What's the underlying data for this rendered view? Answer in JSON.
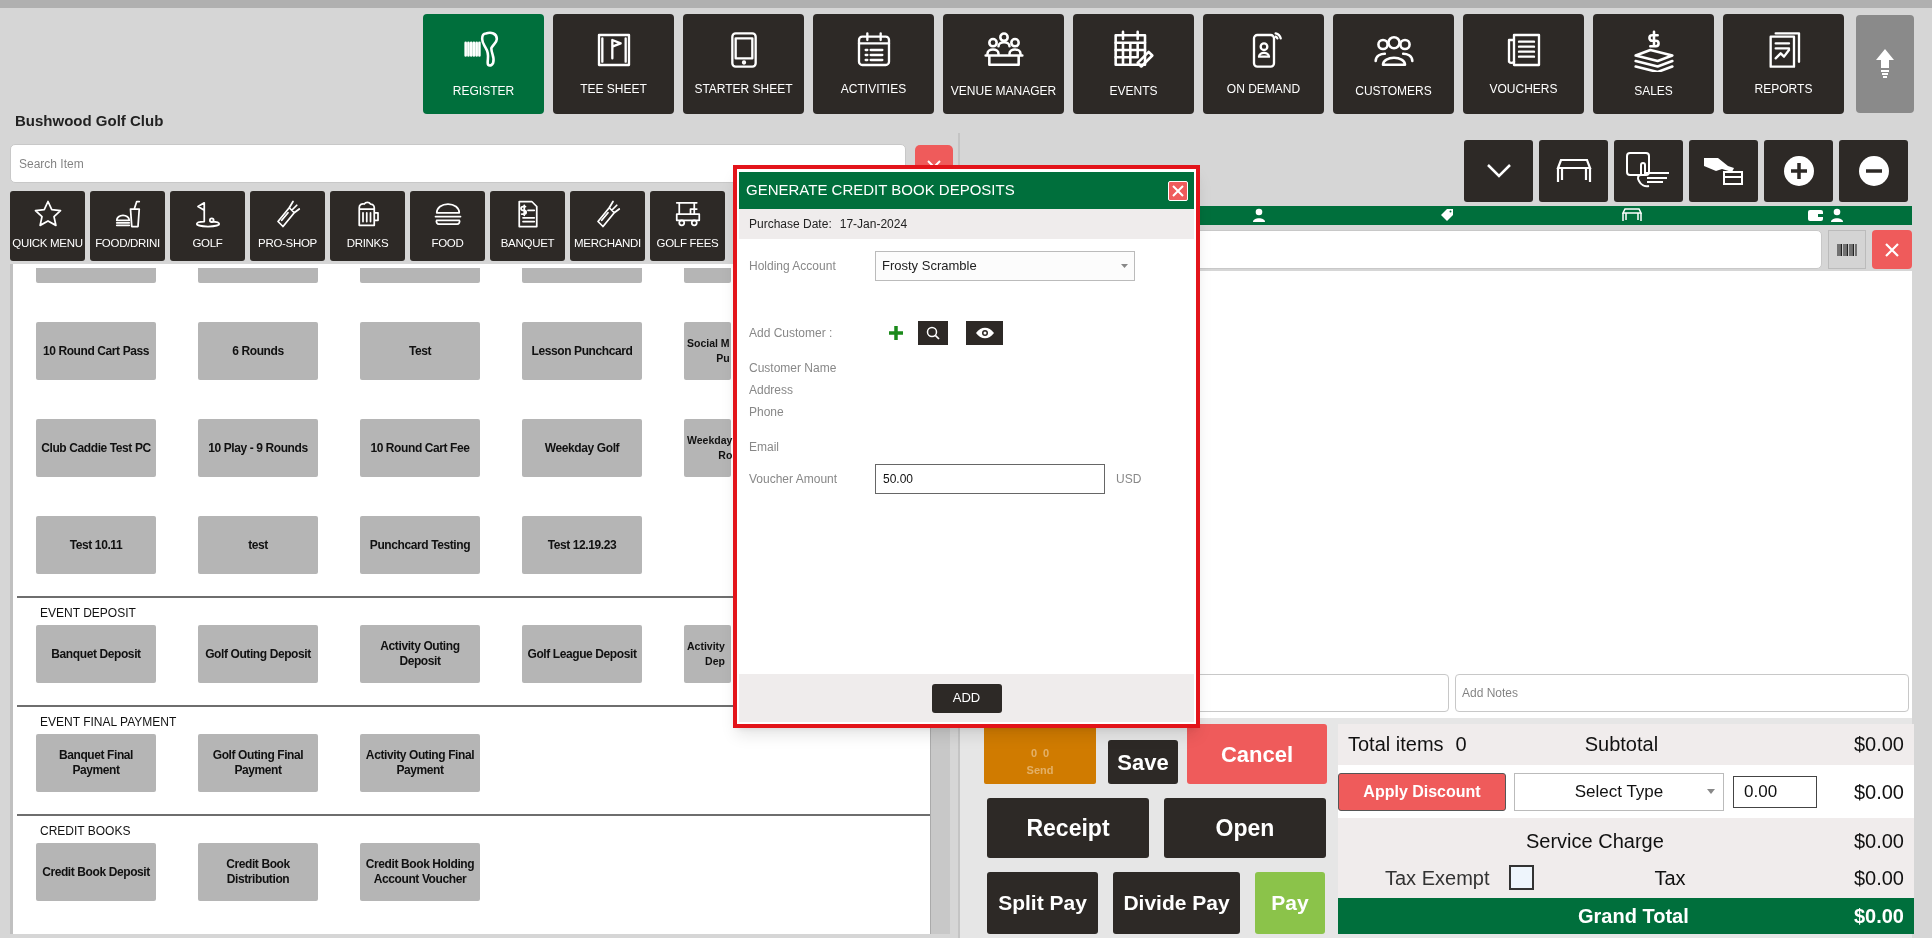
{
  "app_title": "Bushwood Golf Club",
  "nav": [
    {
      "label": "REGISTER",
      "selected": true
    },
    {
      "label": "TEE SHEET",
      "selected": false
    },
    {
      "label": "STARTER SHEET",
      "selected": false
    },
    {
      "label": "ACTIVITIES",
      "selected": false
    },
    {
      "label": "VENUE MANAGER",
      "selected": false
    },
    {
      "label": "EVENTS",
      "selected": false
    },
    {
      "label": "ON DEMAND",
      "selected": false
    },
    {
      "label": "CUSTOMERS",
      "selected": false
    },
    {
      "label": "VOUCHERS",
      "selected": false
    },
    {
      "label": "SALES",
      "selected": false
    },
    {
      "label": "REPORTS",
      "selected": false
    }
  ],
  "search": {
    "placeholder": "Search Item"
  },
  "categories": [
    {
      "label": "QUICK MENU"
    },
    {
      "label": "FOOD/DRINI"
    },
    {
      "label": "GOLF"
    },
    {
      "label": "PRO-SHOP"
    },
    {
      "label": "DRINKS"
    },
    {
      "label": "FOOD"
    },
    {
      "label": "BANQUET"
    },
    {
      "label": "MERCHANDI"
    },
    {
      "label": "GOLF FEES"
    }
  ],
  "item_groups": [
    {
      "rows": [
        [
          {
            "label": "10 Round Cart Pass"
          },
          {
            "label": "6 Rounds"
          },
          {
            "label": "Test"
          },
          {
            "label": "Lesson Punchcard"
          },
          {
            "label": "Social M\nPu",
            "cut": true
          }
        ],
        [
          {
            "label": "Club Caddie Test PC"
          },
          {
            "label": "10 Play - 9 Rounds"
          },
          {
            "label": "10 Round Cart Fee"
          },
          {
            "label": "Weekday Golf"
          },
          {
            "label": "Weekday\nRo",
            "cut": true
          }
        ],
        [
          {
            "label": "Test 10.11"
          },
          {
            "label": "test"
          },
          {
            "label": "Punchcard Testing"
          },
          {
            "label": "Test 12.19.23"
          }
        ]
      ]
    },
    {
      "title": "EVENT DEPOSIT",
      "rows": [
        [
          {
            "label": "Banquet Deposit"
          },
          {
            "label": "Golf Outing Deposit"
          },
          {
            "label": "Activity Outing Deposit"
          },
          {
            "label": "Golf League Deposit"
          },
          {
            "label": "Activity\nDep",
            "cut": true
          }
        ]
      ]
    },
    {
      "title": "EVENT FINAL PAYMENT",
      "rows": [
        [
          {
            "label": "Banquet Final Payment"
          },
          {
            "label": "Golf Outing Final Payment"
          },
          {
            "label": "Activity Outing Final Payment"
          }
        ]
      ]
    },
    {
      "title": "CREDIT BOOKS",
      "rows": [
        [
          {
            "label": "Credit Book Deposit"
          },
          {
            "label": "Credit Book Distribution"
          },
          {
            "label": "Credit Book Holding Account Voucher"
          }
        ]
      ]
    }
  ],
  "notes": {
    "placeholder": "Add Notes"
  },
  "send": {
    "counts": [
      "0",
      "0"
    ],
    "label": "Send",
    "disabled": true
  },
  "actions": [
    {
      "label": "Save",
      "kind": "dark"
    },
    {
      "label": "Cancel",
      "kind": "red"
    },
    {
      "label": "Receipt",
      "kind": "dark"
    },
    {
      "label": "Open",
      "kind": "dark"
    },
    {
      "label": "Split Pay",
      "kind": "dark"
    },
    {
      "label": "Divide Pay",
      "kind": "dark"
    },
    {
      "label": "Pay",
      "kind": "green"
    }
  ],
  "summary": {
    "total_items_label": "Total items",
    "total_items": "0",
    "subtotal_label": "Subtotal",
    "subtotal": "$0.00",
    "apply_discount": "Apply Discount",
    "discount_type": "Select Type",
    "discount_value": "0.00",
    "discount_amount": "$0.00",
    "service_charge_label": "Service Charge",
    "service_charge": "$0.00",
    "tax_exempt": {
      "label": "Tax Exempt",
      "checked": false
    },
    "tax_label": "Tax",
    "tax": "$0.00",
    "grand_total_label": "Grand Total",
    "grand_total": "$0.00"
  },
  "modal": {
    "title": "GENERATE CREDIT BOOK DEPOSITS",
    "purchase_date_label": "Purchase Date:",
    "purchase_date": "17-Jan-2024",
    "holding_account_label": "Holding Account",
    "holding_account": "Frosty Scramble",
    "add_customer_label": "Add Customer :",
    "customer_fields": [
      "Customer Name",
      "Address",
      "Phone",
      "Email"
    ],
    "voucher_amount_label": "Voucher Amount",
    "voucher_amount": "50.00",
    "currency": "USD",
    "add_button": "ADD"
  }
}
